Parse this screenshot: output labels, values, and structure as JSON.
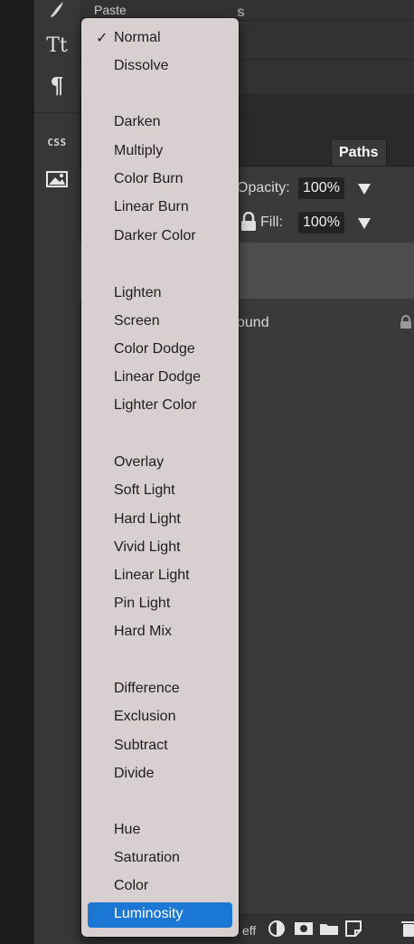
{
  "top_menu": {
    "paste_label": "Paste"
  },
  "tools": {
    "type_glyph": "Tt",
    "paragraph_glyph": "¶",
    "css_label": "CSS"
  },
  "layers_panel": {
    "tab_partial": "s",
    "tab_paths": "Paths",
    "opacity_label": "Opacity:",
    "opacity_value": "100%",
    "fill_label": "Fill:",
    "fill_value": "100%",
    "layer_name": "ound",
    "fx_label": "eff"
  },
  "blend_menu": {
    "checkmark": "✓",
    "items": [
      "Normal",
      "Dissolve",
      "Darken",
      "Multiply",
      "Color Burn",
      "Linear Burn",
      "Darker Color",
      "Lighten",
      "Screen",
      "Color Dodge",
      "Linear Dodge",
      "Lighter Color",
      "Overlay",
      "Soft Light",
      "Hard Light",
      "Vivid Light",
      "Linear Light",
      "Pin Light",
      "Hard Mix",
      "Difference",
      "Exclusion",
      "Subtract",
      "Divide",
      "Hue",
      "Saturation",
      "Color",
      "Luminosity"
    ],
    "checked": "Normal",
    "highlighted": "Luminosity"
  },
  "colors": {
    "highlight": "#1a78d4",
    "menu_bg": "#d8cfd1",
    "panel_bg": "#3a3a3a"
  }
}
